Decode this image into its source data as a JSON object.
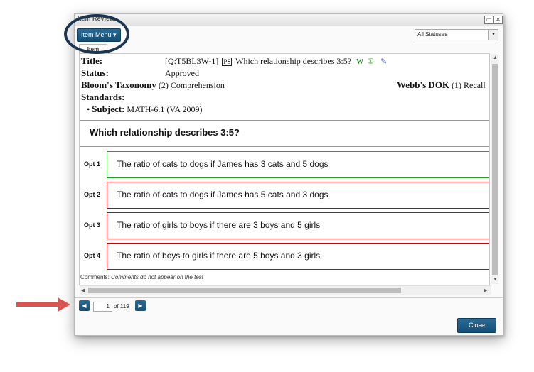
{
  "window": {
    "title": "Item Review",
    "minimize_glyph": "▭",
    "close_glyph": "✕"
  },
  "toolbar": {
    "item_menu_label": "Item Menu ▾",
    "status_filter_value": "All Statuses",
    "status_arrow": "▾"
  },
  "tabs": [
    {
      "label": "Item",
      "active": true
    }
  ],
  "item": {
    "title_label": "Title:",
    "title_value": "[Q:T5BL3W-1]",
    "ps_badge": "PS",
    "title_text": "Which relationship describes 3:5?",
    "title_icons": [
      "word-icon",
      "one-circle-icon",
      "pen-icon"
    ],
    "title_icon_glyphs": [
      "W",
      "①",
      "✎"
    ],
    "status_label": "Status:",
    "status_value": "Approved",
    "bloom_label": "Bloom's Taxonomy",
    "bloom_value": "(2) Comprehension",
    "webb_label": "Webb's DOK",
    "webb_value": "(1) Recall",
    "standards_label": "Standards:",
    "subject_bullet": "•",
    "subject_label": "Subject:",
    "subject_value": "MATH-6.1 (VA 2009)"
  },
  "question": {
    "stem": "Which relationship describes 3:5?"
  },
  "options": [
    {
      "label": "Opt 1",
      "text": "The ratio of cats to dogs if James has 3 cats and 5 dogs",
      "correct": true
    },
    {
      "label": "Opt 2",
      "text": "The ratio of cats to dogs if James has 5 cats and 3 dogs",
      "correct": false
    },
    {
      "label": "Opt 3",
      "text": "The ratio of girls to boys if there are 3 boys and 5 girls",
      "correct": false
    },
    {
      "label": "Opt 4",
      "text": "The ratio of boys to girls if there are 5 boys and 3 girls",
      "correct": false
    }
  ],
  "comments": {
    "label": "Comments:",
    "note": "Comments do not appear on the test"
  },
  "pager": {
    "prev_glyph": "◀",
    "next_glyph": "▶",
    "current_page": "1",
    "of_text": "of 119"
  },
  "footer": {
    "close_label": "Close"
  },
  "colors": {
    "accent": "#1a5a85",
    "correct_border": "#2aa02a",
    "incorrect_border": "#cc0000",
    "annotation": "#1c3550",
    "arrow": "#d9534f"
  }
}
